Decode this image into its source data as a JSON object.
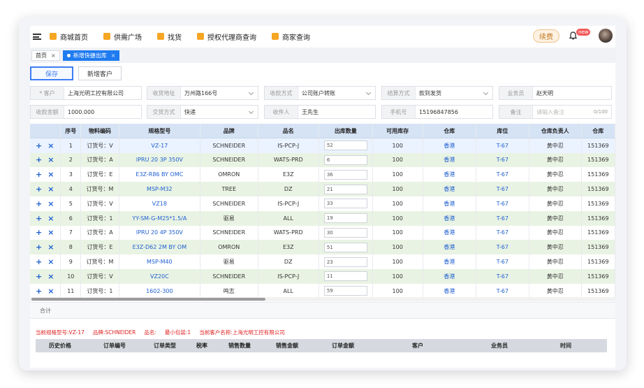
{
  "nav": {
    "items": [
      {
        "label": "商城首页",
        "icon": "home-icon"
      },
      {
        "label": "供需广场",
        "icon": "megaphone-icon"
      },
      {
        "label": "找货",
        "icon": "search-goods-icon"
      },
      {
        "label": "授权代理商查询",
        "icon": "certificate-icon"
      },
      {
        "label": "商家查询",
        "icon": "shop-icon"
      }
    ],
    "renew_label": "续费",
    "badge": "new"
  },
  "tabs": [
    {
      "label": "首页",
      "close": "×"
    },
    {
      "label": "新增快捷出库",
      "close": "×"
    }
  ],
  "actions": {
    "save": "保存",
    "add_customer": "新增客户"
  },
  "form": {
    "row1": [
      {
        "label": "* 客户",
        "value": "上海光明工控有限公司"
      },
      {
        "label": "收货地址",
        "value": "万州路166号"
      },
      {
        "label": "收款方式",
        "value": "公司账户转账"
      },
      {
        "label": "结算方式",
        "value": "款到发货"
      },
      {
        "label": "业务员",
        "value": "赵天明"
      }
    ],
    "row2": [
      {
        "label": "收款金额",
        "value": "1000.000"
      },
      {
        "label": "交货方式",
        "value": "快递"
      },
      {
        "label": "收件人",
        "value": "王先生"
      },
      {
        "label": "手机号",
        "value": "15196847856"
      },
      {
        "label": "备注",
        "value": "请输入备注",
        "counter": "0/100"
      }
    ]
  },
  "grid": {
    "columns": [
      "",
      "序号",
      "物料编码",
      "规格型号",
      "品牌",
      "品名",
      "出库数量",
      "可用库存",
      "仓库",
      "库位",
      "仓库负责人",
      "仓库"
    ],
    "rows": [
      {
        "no": "1",
        "code": "订货号：V",
        "spec": "VZ-17",
        "brand": "SCHNEIDER",
        "name": "IS-PCP-J",
        "qty": "52",
        "stock": "100",
        "wh": "香港",
        "loc": "T-67",
        "owner": "黄中忍",
        "ext": "151369"
      },
      {
        "no": "2",
        "code": "订货号：A",
        "spec": "IPRU 20 3P 350V",
        "brand": "SCHNEIDER",
        "name": "WATS-PRD",
        "qty": "6",
        "stock": "100",
        "wh": "香港",
        "loc": "T-67",
        "owner": "黄中忍",
        "ext": "151369"
      },
      {
        "no": "3",
        "code": "订货号：E",
        "spec": "E3Z-R86 BY OMC",
        "brand": "OMRON",
        "name": "E3Z",
        "qty": "36",
        "stock": "100",
        "wh": "香港",
        "loc": "T-67",
        "owner": "黄中忍",
        "ext": "151369"
      },
      {
        "no": "4",
        "code": "订货号：M",
        "spec": "MSP-M32",
        "brand": "TREE",
        "name": "DZ",
        "qty": "21",
        "stock": "100",
        "wh": "香港",
        "loc": "T-67",
        "owner": "黄中忍",
        "ext": "151369"
      },
      {
        "no": "5",
        "code": "订货号：V",
        "spec": "VZ18",
        "brand": "SCHNEIDER",
        "name": "IS-PCP-J",
        "qty": "33",
        "stock": "100",
        "wh": "香港",
        "loc": "T-67",
        "owner": "黄中忍",
        "ext": "151369"
      },
      {
        "no": "6",
        "code": "订货号：1",
        "spec": "YY-SM-G-M25*1.5/A",
        "brand": "驱易",
        "name": "ALL",
        "qty": "19",
        "stock": "100",
        "wh": "香港",
        "loc": "T-67",
        "owner": "黄中忍",
        "ext": "151369"
      },
      {
        "no": "7",
        "code": "订货号：A",
        "spec": "IPRU 20 4P 350V",
        "brand": "SCHNEIDER",
        "name": "WATS-PRD",
        "qty": "30",
        "stock": "100",
        "wh": "香港",
        "loc": "T-67",
        "owner": "黄中忍",
        "ext": "151369"
      },
      {
        "no": "8",
        "code": "订货号：E",
        "spec": "E3Z-D62 2M BY OM",
        "brand": "OMRON",
        "name": "E3Z",
        "qty": "51",
        "stock": "100",
        "wh": "香港",
        "loc": "T-67",
        "owner": "黄中忍",
        "ext": "151369"
      },
      {
        "no": "9",
        "code": "订货号：M",
        "spec": "MSP-M40",
        "brand": "驱易",
        "name": "DZ",
        "qty": "23",
        "stock": "100",
        "wh": "香港",
        "loc": "T-67",
        "owner": "黄中忍",
        "ext": "151369"
      },
      {
        "no": "10",
        "code": "订货号：V",
        "spec": "VZ20C",
        "brand": "SCHNEIDER",
        "name": "IS-PCP-J",
        "qty": "11",
        "stock": "100",
        "wh": "香港",
        "loc": "T-67",
        "owner": "黄中忍",
        "ext": "151369"
      },
      {
        "no": "11",
        "code": "订货号：1",
        "spec": "1602-300",
        "brand": "鸣志",
        "name": "ALL",
        "qty": "59",
        "stock": "100",
        "wh": "香港",
        "loc": "T-67",
        "owner": "黄中忍",
        "ext": "151369"
      }
    ],
    "summary_label": "合计",
    "add_op": "+",
    "delete_op": "×"
  },
  "info": {
    "spec": "当前规格型号:VZ-17",
    "brand": "品牌:SCHNEIDER",
    "name": "品名:",
    "min_pack": "最小包装:1",
    "customer": "当前客户名称:上海光明工控有限公司"
  },
  "history_columns": [
    "历史价格",
    "订单编号",
    "订单类型",
    "税率",
    "销售数量",
    "销售金额",
    "订单金额",
    "客户",
    "业务员",
    "时间"
  ]
}
